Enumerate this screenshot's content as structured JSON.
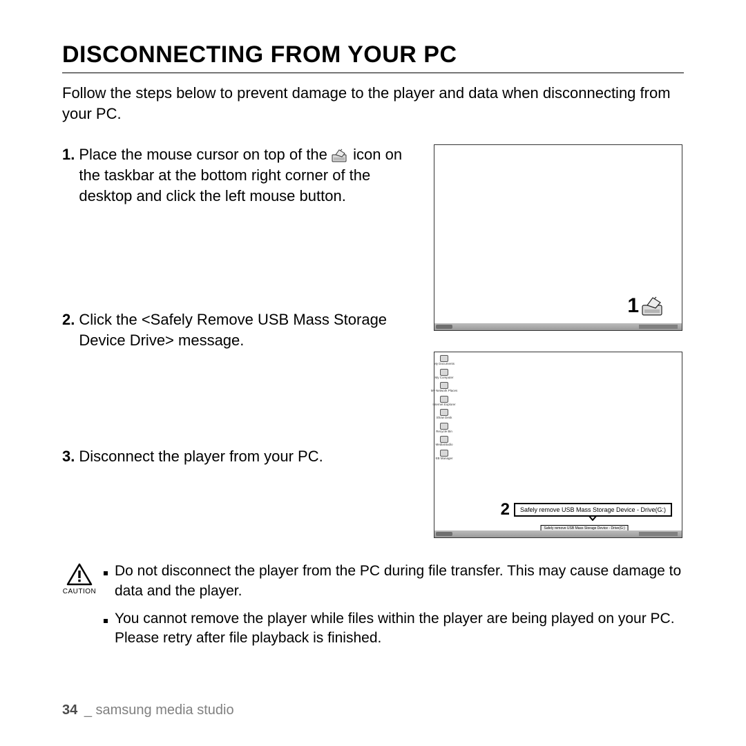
{
  "heading": "DISCONNECTING FROM YOUR PC",
  "intro": "Follow the steps below to prevent damage to the player and data when disconnecting from your PC.",
  "steps": {
    "s1": {
      "num": "1.",
      "text_pre": "Place the mouse cursor on top of the ",
      "text_post": " icon on the taskbar at the bottom right corner of the desktop and click the left mouse button."
    },
    "s2": {
      "num": "2.",
      "text": "Click the <Safely Remove USB Mass Storage Device Drive> message."
    },
    "s3": {
      "num": "3.",
      "text": "Disconnect the player from your PC."
    }
  },
  "figure1": {
    "callout_num": "1"
  },
  "figure2": {
    "callout_num": "2",
    "msg": "Safely remove USB Mass Storage Device - Drive(G:)",
    "msg2": "Safely remove USB Mass Storage Device - Drive(G:)",
    "icons": [
      "My Documents",
      "My Computer",
      "My Network Places",
      "Internet Explorer",
      "Show Desk",
      "Recycle Bin",
      "MediaStudio",
      "EB Manager"
    ]
  },
  "caution": {
    "label": "CAUTION",
    "items": [
      "Do not disconnect the player from the PC during file transfer. This may cause damage to data and the player.",
      "You cannot remove the player while files within the player are being played on your PC. Please retry after file playback is finished."
    ]
  },
  "footer": {
    "page": "34",
    "sep": "_",
    "section": "samsung media studio"
  }
}
